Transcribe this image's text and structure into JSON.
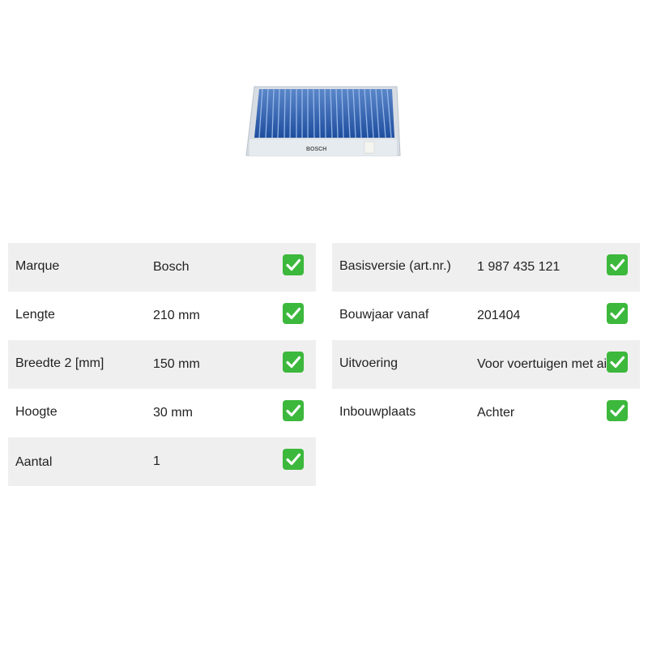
{
  "product": {
    "image_icon": "cabin-filter-product-photo",
    "brand_print": "BOSCH"
  },
  "specs_left": [
    {
      "label": "Marque",
      "value": "Bosch"
    },
    {
      "label": "Lengte",
      "value": "210 mm"
    },
    {
      "label": "Breedte 2 [mm]",
      "value": "150 mm"
    },
    {
      "label": "Hoogte",
      "value": "30 mm"
    },
    {
      "label": "Aantal",
      "value": "1"
    }
  ],
  "specs_right": [
    {
      "label": "Basisversie (art.nr.)",
      "value": "1 987 435 121"
    },
    {
      "label": "Bouwjaar vanaf",
      "value": "201404"
    },
    {
      "label": "Uitvoering",
      "value": "Voor voertuigen met airco"
    },
    {
      "label": "Inbouwplaats",
      "value": "Achter"
    }
  ],
  "colors": {
    "row_shade": "#efefef",
    "check_green": "#3cb83c",
    "filter_blue": "#2a5db0"
  },
  "check_icon": "check-mark-icon"
}
